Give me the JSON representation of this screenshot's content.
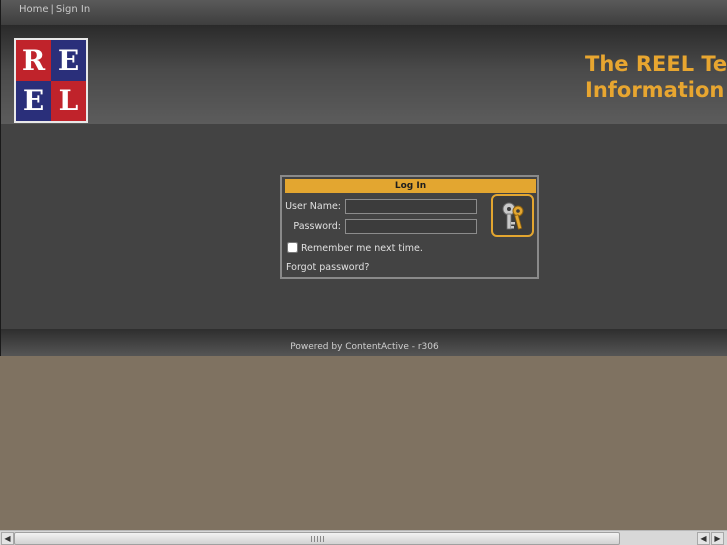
{
  "nav": {
    "home": "Home",
    "separator": "|",
    "sign_in": "Sign In"
  },
  "logo": {
    "letters": [
      "R",
      "E",
      "E",
      "L"
    ],
    "colors": {
      "red": "#c0232b",
      "blue": "#2a2f7a"
    }
  },
  "header": {
    "title_line1": "The REEL Tea",
    "title_line2": "Information S",
    "title_color": "#e8a630"
  },
  "login": {
    "title": "Log In",
    "username_label": "User Name:",
    "username_value": "",
    "password_label": "Password:",
    "password_value": "",
    "submit_icon": "keys-icon",
    "remember_label": "Remember me next time.",
    "remember_checked": false,
    "forgot_label": "Forgot password?",
    "accent": "#e3a630"
  },
  "footer": {
    "text": "Powered by ContentActive - r306"
  },
  "scrollbar": {
    "left_arrow": "◀",
    "right_arrow": "▶"
  }
}
